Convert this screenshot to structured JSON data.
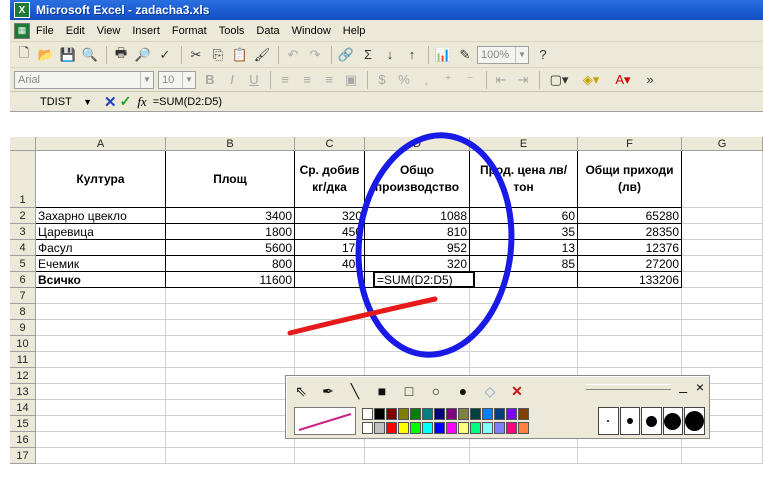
{
  "window": {
    "title": "Microsoft Excel - zadacha3.xls"
  },
  "menu": [
    "File",
    "Edit",
    "View",
    "Insert",
    "Format",
    "Tools",
    "Data",
    "Window",
    "Help"
  ],
  "toolbar": {
    "zoom": "100%",
    "font_name": "Arial",
    "font_size": "10"
  },
  "formula_bar": {
    "name_box": "TDIST",
    "fx": "fx",
    "formula": "=SUM(D2:D5)"
  },
  "columns": [
    "A",
    "B",
    "C",
    "D",
    "E",
    "F",
    "G"
  ],
  "rows": [
    "1",
    "2",
    "3",
    "4",
    "5",
    "6",
    "7",
    "8",
    "9",
    "10",
    "11",
    "12",
    "13",
    "14",
    "15",
    "16",
    "17"
  ],
  "table": {
    "headers": [
      "Култура",
      "Площ",
      "Ср. добив кг/дка",
      "Общо производство",
      "Прод. цена лв/тон",
      "Общи приходи (лв)"
    ],
    "data": [
      [
        "Захарно цвекло",
        "3400",
        "320",
        "1088",
        "60",
        "65280"
      ],
      [
        "Царевица",
        "1800",
        "450",
        "810",
        "35",
        "28350"
      ],
      [
        "Фасул",
        "5600",
        "170",
        "952",
        "13",
        "12376"
      ],
      [
        "Ечемик",
        "800",
        "400",
        "320",
        "85",
        "27200"
      ]
    ],
    "total": [
      "Всичко",
      "11600",
      "",
      "=SUM(D2:D5)",
      "",
      "133206"
    ]
  },
  "pen_palette": [
    "#ffffff",
    "#000000",
    "#800000",
    "#808000",
    "#008000",
    "#008080",
    "#000080",
    "#800080",
    "#808040",
    "#004040",
    "#0080ff",
    "#004080",
    "#8000ff",
    "#804000",
    "#ffffff",
    "#c0c0c0",
    "#ff0000",
    "#ffff00",
    "#00ff00",
    "#00ffff",
    "#0000ff",
    "#ff00ff",
    "#ffff80",
    "#00ff80",
    "#80ffff",
    "#8080ff",
    "#ff0080",
    "#ff8040"
  ],
  "annotation_colors": {
    "ellipse": "#1a1ae6",
    "line": "#e61a1a",
    "pen_preview": "#cc2288"
  }
}
